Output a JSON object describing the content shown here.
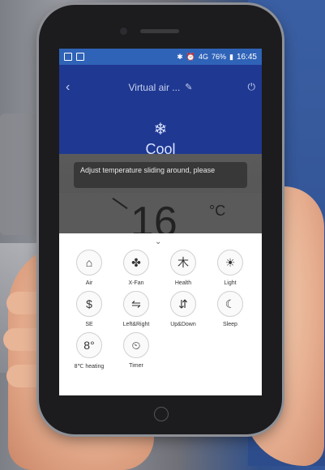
{
  "statusbar": {
    "battery": "76%",
    "time": "16:45",
    "signal": "4G"
  },
  "header": {
    "title": "Virtual air ...",
    "back_icon": "back-arrow-icon",
    "edit_icon": "pencil-icon",
    "power_icon": "power-icon"
  },
  "mode": {
    "icon": "snowflake-icon",
    "label": "Cool"
  },
  "toast": {
    "text": "Adjust temperature sliding around, please"
  },
  "temperature": {
    "value": "16",
    "unit": "°C"
  },
  "functions": [
    {
      "label": "Air",
      "icon": "house-icon"
    },
    {
      "label": "X-Fan",
      "icon": "fan-icon"
    },
    {
      "label": "Health",
      "icon": "tree-icon"
    },
    {
      "label": "Light",
      "icon": "bulb-icon"
    },
    {
      "label": "SE",
      "icon": "dollar-icon"
    },
    {
      "label": "Left&Right",
      "icon": "swing-horizontal-icon"
    },
    {
      "label": "Up&Down",
      "icon": "swing-vertical-icon"
    },
    {
      "label": "Sleep",
      "icon": "moon-icon"
    },
    {
      "label": "8℃ heating",
      "icon": "eight-degree-icon"
    },
    {
      "label": "Timer",
      "icon": "clock-icon"
    }
  ]
}
